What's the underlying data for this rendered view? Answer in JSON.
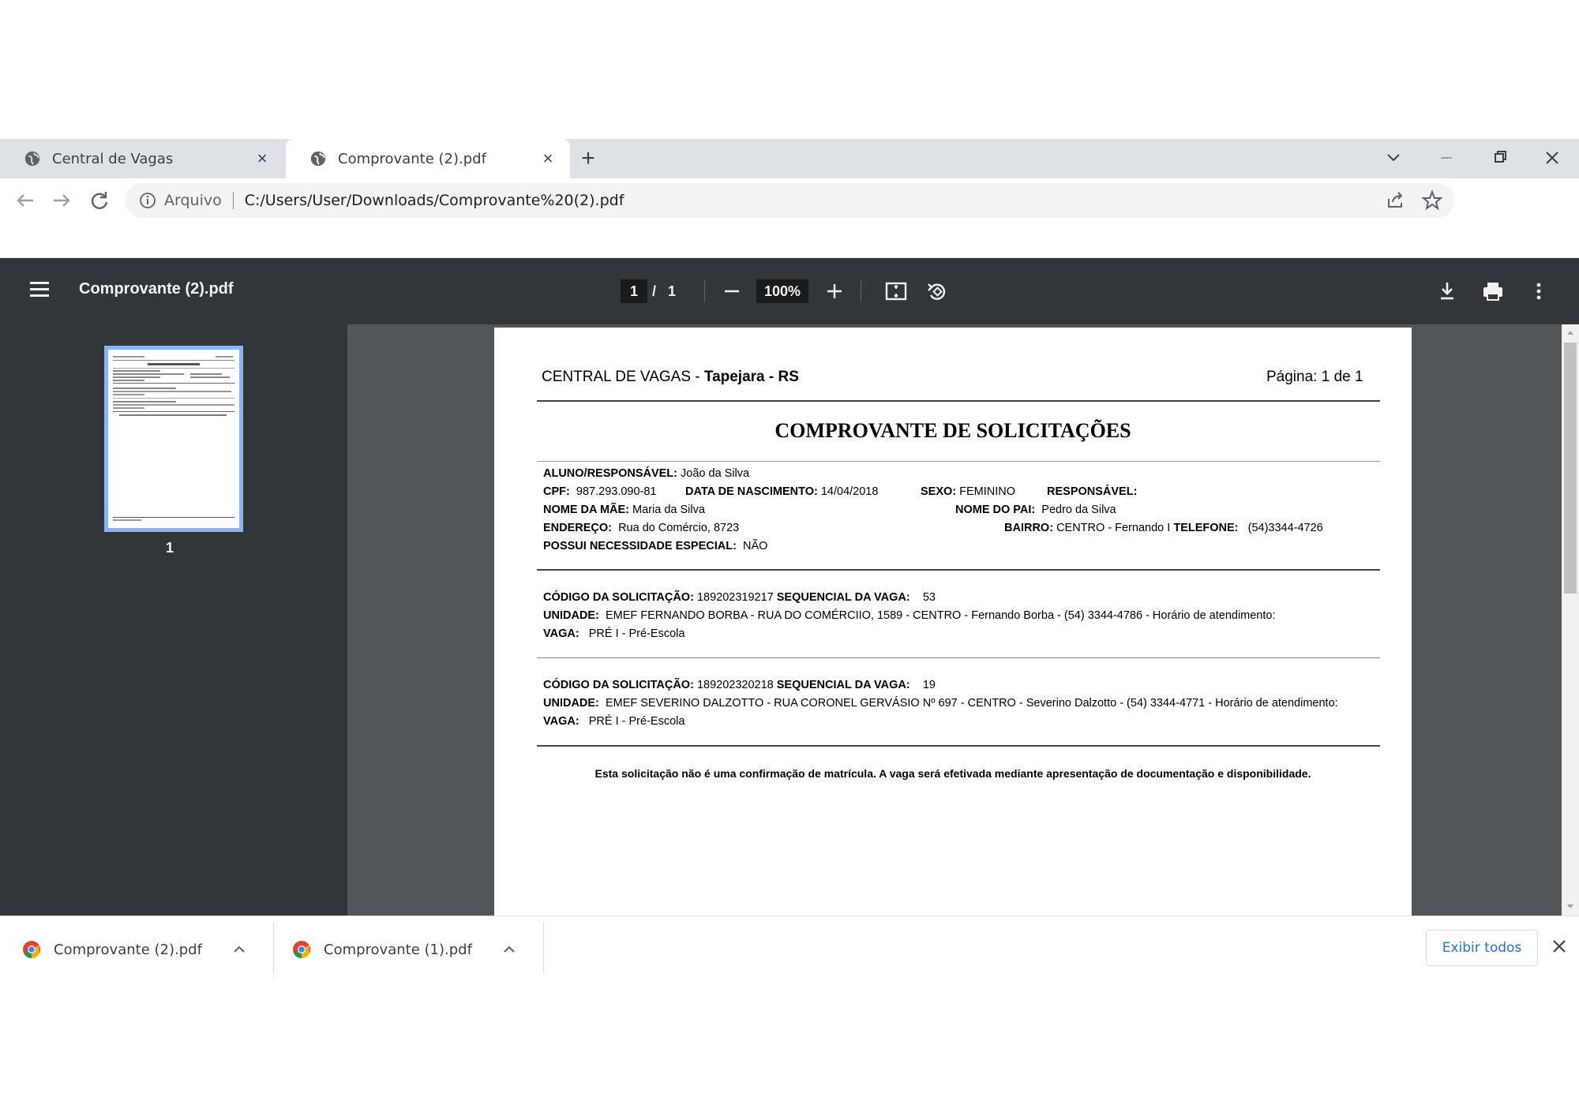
{
  "browser": {
    "tabs": [
      {
        "title": "Central de Vagas"
      },
      {
        "title": "Comprovante (2).pdf"
      }
    ],
    "new_tab_symbol": "+",
    "close_symbol": "×",
    "address": {
      "scheme_label": "Arquivo",
      "url": "C:/Users/User/Downloads/Comprovante%20(2).pdf"
    }
  },
  "pdf_viewer": {
    "title": "Comprovante (2).pdf",
    "page_current": "1",
    "page_separator": "/",
    "page_total": "1",
    "zoom": "100%",
    "thumbnail_label": "1"
  },
  "document": {
    "header_left_plain": "CENTRAL DE VAGAS - ",
    "header_left_bold": "Tapejara - RS",
    "header_right": "Página: 1 de 1",
    "title": "COMPROVANTE DE SOLICITAÇÕES",
    "student": {
      "aluno_label": "ALUNO/RESPONSÁVEL:",
      "aluno_value": "João da Silva",
      "cpf_label": "CPF:",
      "cpf_value": "987.293.090-81",
      "nasc_label": "DATA DE NASCIMENTO:",
      "nasc_value": "14/04/2018",
      "sexo_label": "SEXO:",
      "sexo_value": "FEMININO",
      "resp_label": "RESPONSÁVEL:",
      "mae_label": "NOME DA MÃE:",
      "mae_value": "Maria da Silva",
      "pai_label": "NOME DO PAI:",
      "pai_value": "Pedro da Silva",
      "end_label": "ENDEREÇO:",
      "end_value": "Rua do Comércio, 8723",
      "bairro_label": "BAIRRO:",
      "bairro_value": "CENTRO - Fernando I",
      "tel_label": "TELEFONE:",
      "tel_value": "(54)3344-4726",
      "nec_label": "POSSUI NECESSIDADE ESPECIAL:",
      "nec_value": "NÃO"
    },
    "requests": [
      {
        "codigo_label": "CÓDIGO DA SOLICITAÇÃO:",
        "codigo_value": "189202319217",
        "seq_label": "SEQUENCIAL DA VAGA:",
        "seq_value": "53",
        "unidade_label": "UNIDADE:",
        "unidade_value": "EMEF FERNANDO BORBA - RUA DO COMÉRCIIO, 1589 - CENTRO - Fernando Borba - (54) 3344-4786 - Horário de atendimento:",
        "vaga_label": "VAGA:",
        "vaga_value": "PRÉ I - Pré-Escola"
      },
      {
        "codigo_label": "CÓDIGO DA SOLICITAÇÃO:",
        "codigo_value": "189202320218",
        "seq_label": "SEQUENCIAL DA VAGA:",
        "seq_value": "19",
        "unidade_label": "UNIDADE:",
        "unidade_value": "EMEF SEVERINO DALZOTTO - RUA CORONEL GERVÁSIO Nº 697 - CENTRO - Severino Dalzotto - (54) 3344-4771 - Horário de atendimento:",
        "vaga_label": "VAGA:",
        "vaga_value": "PRÉ I - Pré-Escola"
      }
    ],
    "footer_note": "Esta solicitação não é uma confirmação de matrícula. A vaga será efetivada mediante apresentação de documentação e disponibilidade."
  },
  "downloads": {
    "items": [
      {
        "name": "Comprovante (2).pdf"
      },
      {
        "name": "Comprovante (1).pdf"
      }
    ],
    "show_all_label": "Exibir todos"
  },
  "colors": {
    "tabstrip": "#dee1e6",
    "pdf_toolbar": "#323639",
    "viewer_bg": "#525659",
    "thumb_border": "#8ab4f8",
    "link_blue": "#1a73e8"
  }
}
